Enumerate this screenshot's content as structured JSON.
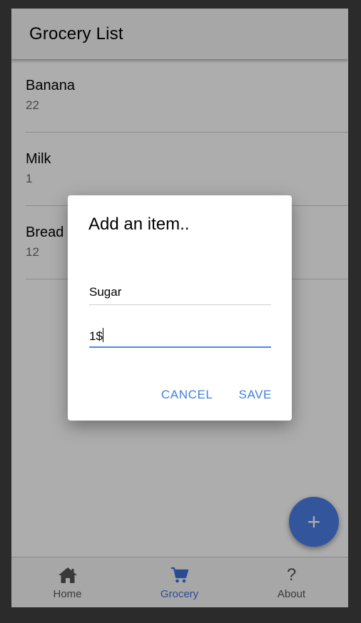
{
  "header": {
    "title": "Grocery List"
  },
  "list": {
    "items": [
      {
        "name": "Banana",
        "quantity": "22"
      },
      {
        "name": "Milk",
        "quantity": "1"
      },
      {
        "name": "Bread",
        "quantity": "12"
      }
    ]
  },
  "dialog": {
    "title": "Add an item..",
    "name_field_value": "Sugar",
    "quantity_field_value": "1$",
    "cancel_label": "CANCEL",
    "save_label": "SAVE"
  },
  "fab": {
    "icon": "plus-icon",
    "glyph": "+"
  },
  "tabbar": {
    "tabs": [
      {
        "label": "Home",
        "icon": "home-icon",
        "active": false
      },
      {
        "label": "Grocery",
        "icon": "cart-icon",
        "active": true
      },
      {
        "label": "About",
        "icon": "question-icon",
        "active": false,
        "glyph": "?"
      }
    ]
  },
  "colors": {
    "accent": "#4a7ee6",
    "active_tab": "#3f6fd6",
    "header_bg": "#f7f7f7"
  }
}
